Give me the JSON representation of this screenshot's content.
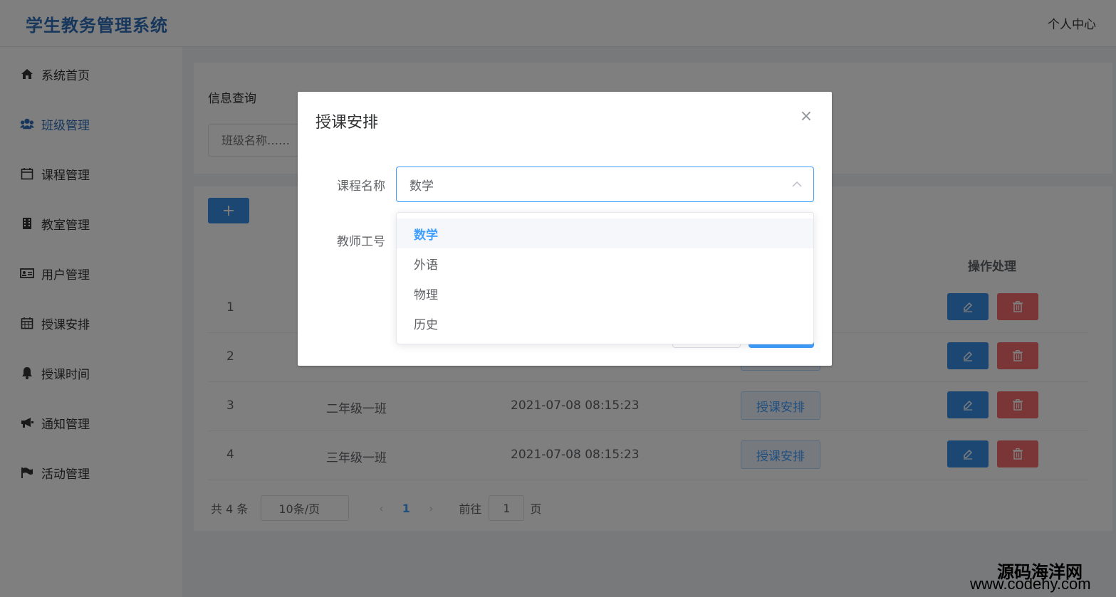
{
  "header": {
    "brand": "学生教务管理系统",
    "user_center": "个人中心"
  },
  "sidebar": {
    "items": [
      {
        "label": "系统首页",
        "icon": "home-icon"
      },
      {
        "label": "班级管理",
        "icon": "users-icon",
        "active": true
      },
      {
        "label": "课程管理",
        "icon": "calendar-icon"
      },
      {
        "label": "教室管理",
        "icon": "building-icon"
      },
      {
        "label": "用户管理",
        "icon": "id-card-icon"
      },
      {
        "label": "授课安排",
        "icon": "calendar-grid-icon"
      },
      {
        "label": "授课时间",
        "icon": "bell-icon"
      },
      {
        "label": "通知管理",
        "icon": "bullhorn-icon"
      },
      {
        "label": "活动管理",
        "icon": "flag-icon"
      }
    ]
  },
  "query": {
    "title": "信息查询",
    "placeholder": "班级名称……"
  },
  "table": {
    "add_label": "+",
    "op_header": "操作处理",
    "assign_label": "授课安排",
    "rows": [
      {
        "index": "1",
        "name": "",
        "time": "",
        "show_assign": false
      },
      {
        "index": "2",
        "name": "",
        "time": "",
        "show_assign": true
      },
      {
        "index": "3",
        "name": "二年级一班",
        "time": "2021-07-08 08:15:23",
        "show_assign": true
      },
      {
        "index": "4",
        "name": "三年级一班",
        "time": "2021-07-08 08:15:23",
        "show_assign": true
      }
    ]
  },
  "pagination": {
    "total": "共 4 条",
    "page_size": "10条/页",
    "current": "1",
    "goto_prefix": "前往",
    "goto_value": "1",
    "goto_suffix": "页"
  },
  "dialog": {
    "title": "授课安排",
    "close": "×",
    "course_label": "课程名称",
    "course_value": "数学",
    "teacher_label": "教师工号",
    "options": [
      "数学",
      "外语",
      "物理",
      "历史"
    ],
    "selected": "数学"
  },
  "watermark": {
    "line1": "源码海洋网",
    "line2": "www.codehy.com"
  },
  "colors": {
    "brand": "#2f6fb8",
    "primary": "#409eff",
    "danger": "#f56c6c"
  }
}
